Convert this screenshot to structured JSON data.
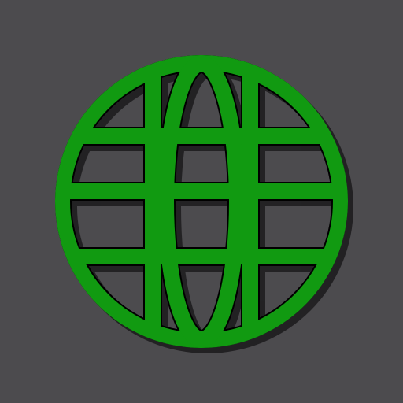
{
  "app": {
    "icon_name": "globe-icon",
    "background_color": "#4c4b4e"
  },
  "globe": {
    "stroke_color": "#119a11",
    "outline_color": "#000000",
    "shadow_color": "#1c1b1d"
  }
}
